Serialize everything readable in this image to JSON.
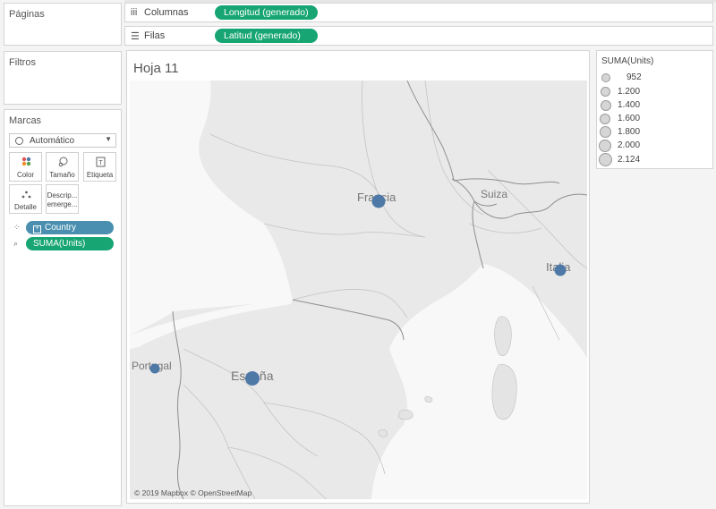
{
  "colors": {
    "dimension_pill": "#4a8fb0",
    "measure_pill": "#17a673",
    "mark": "#4e79a7"
  },
  "pages_card": {
    "title": "Páginas"
  },
  "filters_card": {
    "title": "Filtros"
  },
  "marks_card": {
    "title": "Marcas",
    "mark_type": "Automático",
    "buttons": {
      "color": "Color",
      "size": "Tamaño",
      "label": "Etiqueta",
      "detail": "Detalle",
      "tooltip_line1": "Descrip...",
      "tooltip_line2": "emerge..."
    },
    "fields": {
      "country": "Country",
      "units": "SUMA(Units)"
    }
  },
  "shelves": {
    "columns": {
      "icon": "columns-icon",
      "label": "Columnas",
      "pill": "Longitud (generado)"
    },
    "rows": {
      "icon": "rows-icon",
      "label": "Filas",
      "pill": "Latitud (generado)"
    }
  },
  "sheet": {
    "title": "Hoja 11"
  },
  "map": {
    "labels": {
      "france": "Francia",
      "switzerland": "Suiza",
      "italy": "Italia",
      "portugal": "Portugal",
      "spain": "España"
    },
    "attribution": "© 2019 Mapbox © OpenStreetMap"
  },
  "legend": {
    "title": "SUMA(Units)",
    "items": [
      "952",
      "1.200",
      "1.400",
      "1.600",
      "1.800",
      "2.000",
      "2.124"
    ]
  }
}
